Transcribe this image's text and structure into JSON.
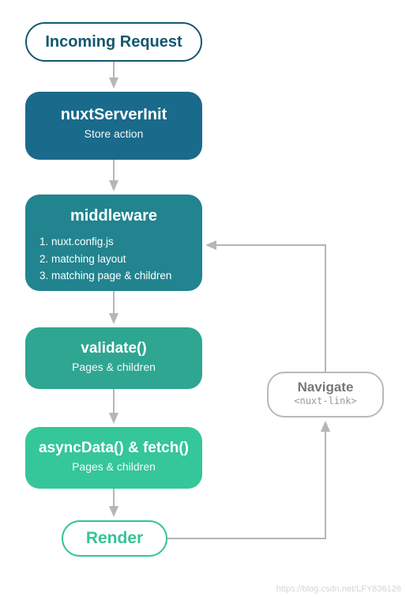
{
  "nodes": {
    "incoming": {
      "label": "Incoming Request"
    },
    "nuxtServerInit": {
      "title": "nuxtServerInit",
      "subtitle": "Store action"
    },
    "middleware": {
      "title": "middleware",
      "items": [
        "1. nuxt.config.js",
        "2. matching layout",
        "3. matching page & children"
      ]
    },
    "validate": {
      "title": "validate()",
      "subtitle": "Pages & children"
    },
    "asyncData": {
      "title": "asyncData() & fetch()",
      "subtitle": "Pages & children"
    },
    "render": {
      "label": "Render"
    },
    "navigate": {
      "title": "Navigate",
      "subtitle": "<nuxt-link>"
    }
  },
  "colors": {
    "incomingBorder": "#14576f",
    "nuxtServerInit": "#1a6a8b",
    "middleware": "#21848f",
    "validate": "#2ea692",
    "asyncData": "#35c699",
    "renderBorder": "#37c398",
    "navigateBorder": "#b9b9b9",
    "arrow": "#b6b6b6"
  },
  "flow": [
    {
      "from": "incoming",
      "to": "nuxtServerInit"
    },
    {
      "from": "nuxtServerInit",
      "to": "middleware"
    },
    {
      "from": "middleware",
      "to": "validate"
    },
    {
      "from": "validate",
      "to": "asyncData"
    },
    {
      "from": "asyncData",
      "to": "render"
    },
    {
      "from": "render",
      "to": "navigate"
    },
    {
      "from": "navigate",
      "to": "middleware"
    }
  ],
  "watermark": "https://blog.csdn.net/LFY836126"
}
